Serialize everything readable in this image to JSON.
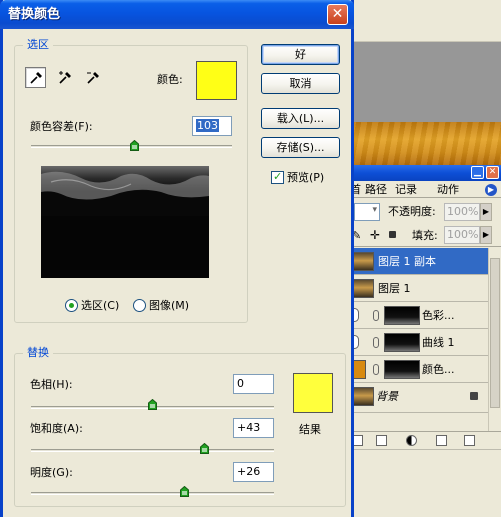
{
  "dialog": {
    "title": "替换颜色",
    "close_glyph": "✕",
    "selection_group": {
      "legend": "选区",
      "color_label": "颜色:",
      "color_swatch": "#ffff16",
      "tools": [
        "eyedropper-icon",
        "eyedropper-plus-icon",
        "eyedropper-minus-icon"
      ],
      "fuzziness_label": "颜色容差(F):",
      "fuzziness_value": "103",
      "fuzziness_max": 200,
      "radio_selection": "选区(C)",
      "radio_image": "图像(M)",
      "selected_mode": "selection"
    },
    "buttons": {
      "ok": "好",
      "cancel": "取消",
      "load": "载入(L)...",
      "save": "存储(S)...",
      "preview": "预览(P)",
      "preview_checked": true
    },
    "replace_group": {
      "legend": "替换",
      "hue_label": "色相(H):",
      "hue_value": "0",
      "hue_range": [
        -180,
        180
      ],
      "saturation_label": "饱和度(A):",
      "saturation_value": "+43",
      "saturation_range": [
        -100,
        100
      ],
      "lightness_label": "明度(G):",
      "lightness_value": "+26",
      "lightness_range": [
        -100,
        100
      ],
      "result_label": "结果",
      "result_swatch": "#ffff3c"
    }
  },
  "layers_panel": {
    "tabs": [
      "图层",
      "路径",
      "记录",
      "动作"
    ],
    "tab_visible": [
      "首",
      "路径",
      "记录",
      "动作"
    ],
    "opacity_label": "不透明度:",
    "opacity_value": "100%",
    "fill_label": "填充:",
    "fill_value": "100%",
    "layers": [
      {
        "name": "图层 1 副本",
        "selected": true
      },
      {
        "name": "图层 1",
        "selected": false
      },
      {
        "name": "色彩...",
        "selected": false
      },
      {
        "name": "曲线 1",
        "selected": false
      },
      {
        "name": "颜色...",
        "selected": false
      },
      {
        "name": "背景",
        "selected": false
      }
    ]
  },
  "colors": {
    "titlebar": "#0a5fe8",
    "dialog_bg": "#ece9d8",
    "group_legend": "#0046d5",
    "selection_highlight": "#316ac5"
  }
}
